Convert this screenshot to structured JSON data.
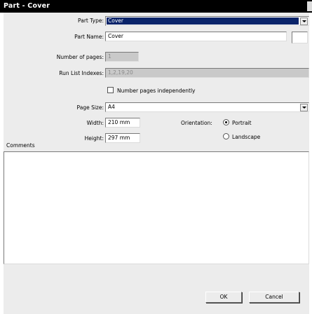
{
  "window": {
    "title": "Part - Cover"
  },
  "form": {
    "part_type": {
      "label": "Part Type:",
      "value": "Cover"
    },
    "part_name": {
      "label": "Part Name:",
      "value": "Cover"
    },
    "number_of_pages": {
      "label": "Number of pages:",
      "value": "1"
    },
    "run_list_indexes": {
      "label": "Run List Indexes:",
      "value": "1,2,19,20"
    },
    "number_independently": {
      "label": "Number pages independently",
      "checked": false
    },
    "page_size": {
      "label": "Page Size:",
      "value": "A4"
    },
    "width": {
      "label": "Width:",
      "value": "210 mm"
    },
    "height": {
      "label": "Height:",
      "value": "297 mm"
    },
    "orientation": {
      "label": "Orientation:",
      "portrait": "Portrait",
      "landscape": "Landscape",
      "selected": "Portrait"
    },
    "comments": {
      "label": "Comments",
      "value": ""
    }
  },
  "buttons": {
    "ok": "OK",
    "cancel": "Cancel"
  },
  "colors": {
    "selection": "#0a246a",
    "titlebar": "#000000",
    "dialog": "#ececec"
  },
  "icons": {
    "dropdown": "chevron-down-icon",
    "close": "close-icon"
  }
}
